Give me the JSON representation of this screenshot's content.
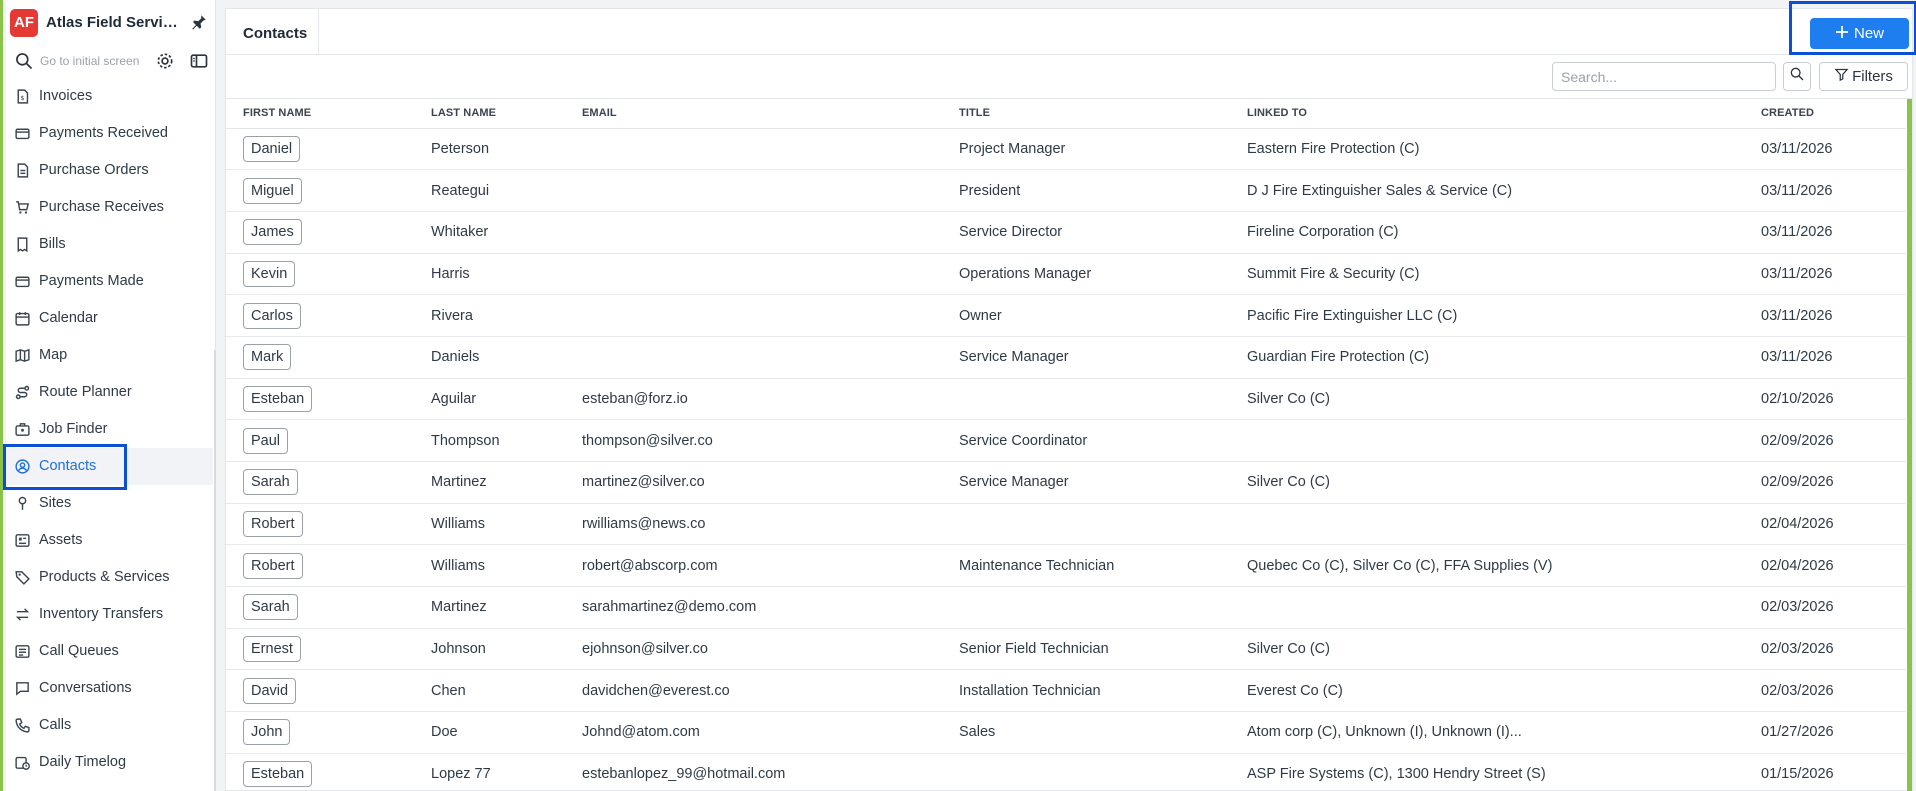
{
  "sidebar": {
    "logo": "AF",
    "org_name": "Atlas Field Services",
    "search_hint": "Go to initial screen",
    "items": [
      {
        "label": "Invoices",
        "icon": "invoice-icon"
      },
      {
        "label": "Payments Received",
        "icon": "card-icon"
      },
      {
        "label": "Purchase Orders",
        "icon": "document-icon"
      },
      {
        "label": "Purchase Receives",
        "icon": "cart-icon"
      },
      {
        "label": "Bills",
        "icon": "bill-icon"
      },
      {
        "label": "Payments Made",
        "icon": "card-icon"
      },
      {
        "label": "Calendar",
        "icon": "calendar-icon"
      },
      {
        "label": "Map",
        "icon": "map-icon"
      },
      {
        "label": "Route Planner",
        "icon": "route-icon"
      },
      {
        "label": "Job Finder",
        "icon": "job-icon"
      },
      {
        "label": "Contacts",
        "icon": "contact-icon"
      },
      {
        "label": "Sites",
        "icon": "pin-icon"
      },
      {
        "label": "Assets",
        "icon": "asset-icon"
      },
      {
        "label": "Products & Services",
        "icon": "tag-icon"
      },
      {
        "label": "Inventory Transfers",
        "icon": "transfer-icon"
      },
      {
        "label": "Call Queues",
        "icon": "queue-icon"
      },
      {
        "label": "Conversations",
        "icon": "chat-icon"
      },
      {
        "label": "Calls",
        "icon": "phone-icon"
      },
      {
        "label": "Daily Timelog",
        "icon": "timelog-icon"
      }
    ],
    "active": "Contacts"
  },
  "main": {
    "tab_label": "Contacts",
    "new_label": "New",
    "search_placeholder": "Search...",
    "filters_label": "Filters",
    "columns": [
      "FIRST NAME",
      "LAST NAME",
      "EMAIL",
      "TITLE",
      "LINKED TO",
      "CREATED"
    ],
    "rows": [
      [
        "Daniel",
        "Peterson",
        "",
        "Project Manager",
        "Eastern Fire Protection (C)",
        "03/11/2026"
      ],
      [
        "Miguel",
        "Reategui",
        "",
        "President",
        "D J Fire Extinguisher Sales & Service (C)",
        "03/11/2026"
      ],
      [
        "James",
        "Whitaker",
        "",
        "Service Director",
        "Fireline Corporation (C)",
        "03/11/2026"
      ],
      [
        "Kevin",
        "Harris",
        "",
        "Operations Manager",
        "Summit Fire & Security (C)",
        "03/11/2026"
      ],
      [
        "Carlos",
        "Rivera",
        "",
        "Owner",
        "Pacific Fire Extinguisher LLC (C)",
        "03/11/2026"
      ],
      [
        "Mark",
        "Daniels",
        "",
        "Service Manager",
        "Guardian Fire Protection (C)",
        "03/11/2026"
      ],
      [
        "Esteban",
        "Aguilar",
        "esteban@forz.io",
        "",
        "Silver Co (C)",
        "02/10/2026"
      ],
      [
        "Paul",
        "Thompson",
        "thompson@silver.co",
        "Service Coordinator",
        "",
        "02/09/2026"
      ],
      [
        "Sarah",
        "Martinez",
        "martinez@silver.co",
        "Service Manager",
        "Silver Co (C)",
        "02/09/2026"
      ],
      [
        "Robert",
        "Williams",
        "rwilliams@news.co",
        "",
        "",
        "02/04/2026"
      ],
      [
        "Robert",
        "Williams",
        "robert@abscorp.com",
        "Maintenance Technician",
        "Quebec Co (C), Silver Co (C), FFA Supplies (V)",
        "02/04/2026"
      ],
      [
        "Sarah",
        "Martinez",
        "sarahmartinez@demo.com",
        "",
        "",
        "02/03/2026"
      ],
      [
        "Ernest",
        "Johnson",
        "ejohnson@silver.co",
        "Senior Field Technician",
        "Silver Co (C)",
        "02/03/2026"
      ],
      [
        "David",
        "Chen",
        "davidchen@everest.co",
        "Installation Technician",
        "Everest Co (C)",
        "02/03/2026"
      ],
      [
        "John",
        "Doe",
        "Johnd@atom.com",
        "Sales",
        "Atom corp (C), Unknown (I), Unknown (I)...",
        "01/27/2026"
      ],
      [
        "Esteban",
        "Lopez 77",
        "estebanlopez_99@hotmail.com",
        "",
        "ASP Fire Systems (C), 1300 Hendry Street (S)",
        "01/15/2026"
      ]
    ]
  },
  "colors": {
    "accent": "#1e7ef0",
    "highlight": "#0b4fd6",
    "logo": "#e53935",
    "edge": "#8bc34a"
  }
}
